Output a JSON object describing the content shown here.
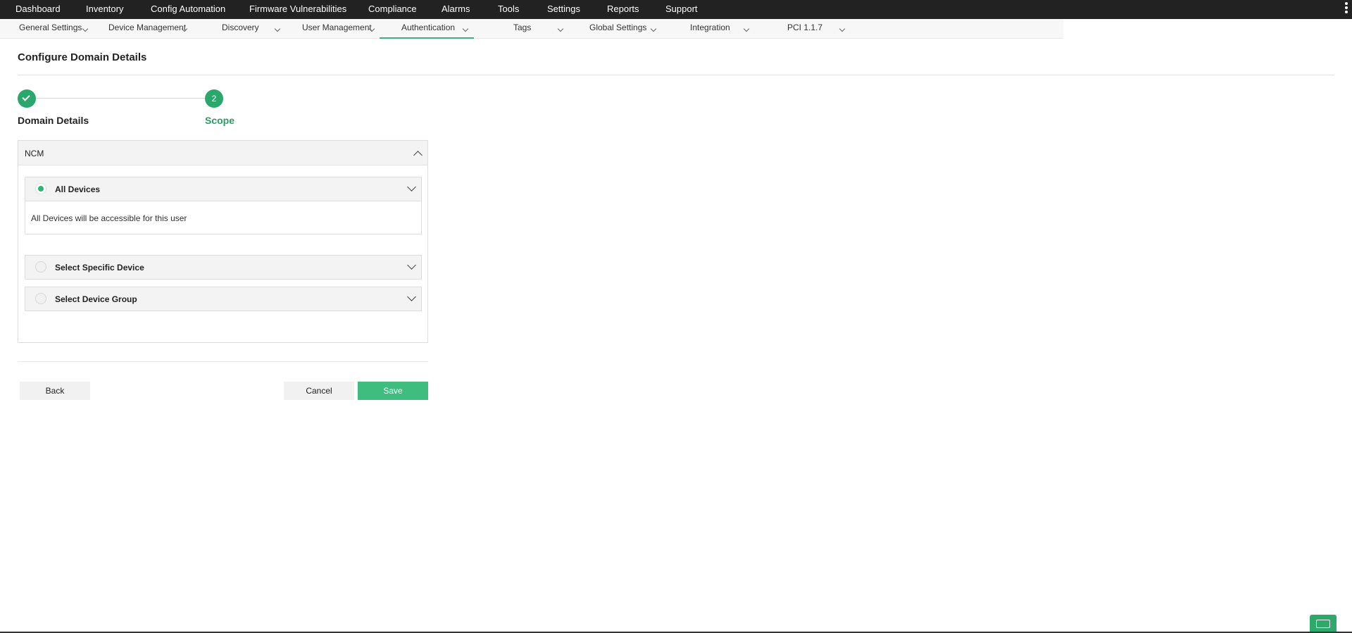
{
  "topnav": {
    "items": [
      {
        "label": "Dashboard"
      },
      {
        "label": "Inventory"
      },
      {
        "label": "Config Automation"
      },
      {
        "label": "Firmware Vulnerabilities"
      },
      {
        "label": "Compliance"
      },
      {
        "label": "Alarms"
      },
      {
        "label": "Tools"
      },
      {
        "label": "Settings"
      },
      {
        "label": "Reports"
      },
      {
        "label": "Support"
      }
    ],
    "more_icon": "kebab-icon"
  },
  "subnav": {
    "active": "Authentication",
    "items": [
      {
        "label": "General Settings"
      },
      {
        "label": "Device Management"
      },
      {
        "label": "Discovery"
      },
      {
        "label": "User Management"
      },
      {
        "label": "Authentication"
      },
      {
        "label": "Tags"
      },
      {
        "label": "Global Settings"
      },
      {
        "label": "Integration"
      },
      {
        "label": "PCI 1.1.7"
      }
    ]
  },
  "page": {
    "title": "Configure Domain Details"
  },
  "stepper": {
    "steps": [
      {
        "label": "Domain Details",
        "status": "complete"
      },
      {
        "label": "Scope",
        "number": "2",
        "status": "current"
      }
    ]
  },
  "panel": {
    "title": "NCM",
    "options": [
      {
        "label": "All Devices",
        "selected": true,
        "description": "All Devices will be accessible for this user"
      },
      {
        "label": "Select Specific Device",
        "selected": false
      },
      {
        "label": "Select Device Group",
        "selected": false
      }
    ]
  },
  "actions": {
    "back": "Back",
    "cancel": "Cancel",
    "save": "Save"
  },
  "colors": {
    "accent": "#2aa76a",
    "save": "#3fbd7f",
    "nav_bg": "#222222"
  }
}
